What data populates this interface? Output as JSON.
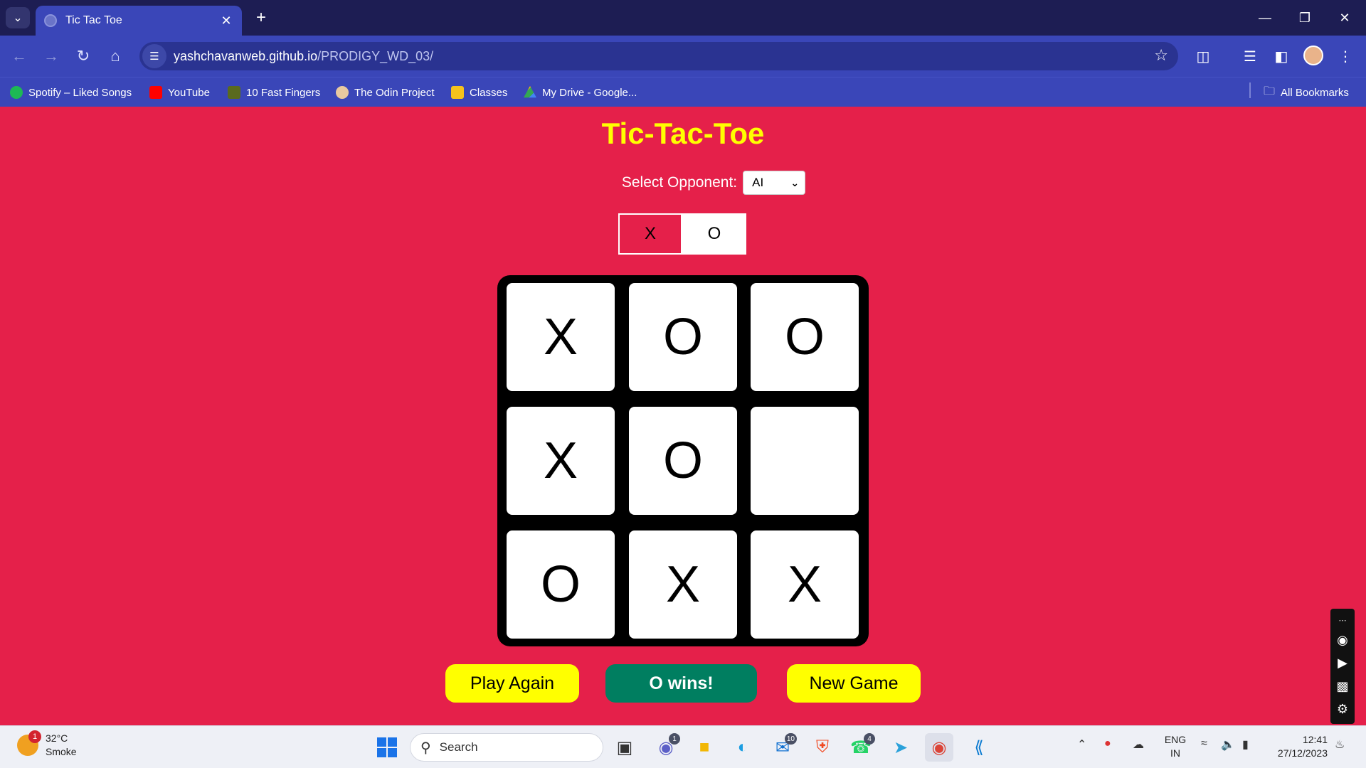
{
  "browser": {
    "tab_title": "Tic Tac Toe",
    "url_host": "yashchavanweb.github.io",
    "url_path": "/PRODIGY_WD_03/",
    "bookmarks": [
      {
        "label": "Spotify – Liked Songs",
        "icon": "spotify-icon",
        "color": "#1db954"
      },
      {
        "label": "YouTube",
        "icon": "youtube-icon",
        "color": "#ff0000"
      },
      {
        "label": "10 Fast Fingers",
        "icon": "fast-fingers-icon",
        "color": "#5a6a1e"
      },
      {
        "label": "The Odin Project",
        "icon": "odin-project-icon",
        "color": "#e8c9a0"
      },
      {
        "label": "Classes",
        "icon": "classroom-icon",
        "color": "#f6c21c"
      },
      {
        "label": "My Drive - Google...",
        "icon": "google-drive-icon",
        "color": "#34a853"
      }
    ],
    "all_bookmarks": "All Bookmarks"
  },
  "game": {
    "title": "Tic-Tac-Toe",
    "opponent_label": "Select Opponent:",
    "opponent_value": "AI",
    "symbol_x": "X",
    "symbol_o": "O",
    "board": [
      "X",
      "O",
      "O",
      "X",
      "O",
      "",
      "O",
      "X",
      "X"
    ],
    "play_again": "Play Again",
    "status": "O wins!",
    "new_game": "New Game"
  },
  "taskbar": {
    "weather_temp": "32°C",
    "weather_desc": "Smoke",
    "weather_badge": "1",
    "search_label": "Search",
    "teams_badge": "1",
    "mail_badge": "10",
    "whatsapp_badge": "4",
    "lang_top": "ENG",
    "lang_bottom": "IN",
    "time": "12:41",
    "date": "27/12/2023"
  }
}
